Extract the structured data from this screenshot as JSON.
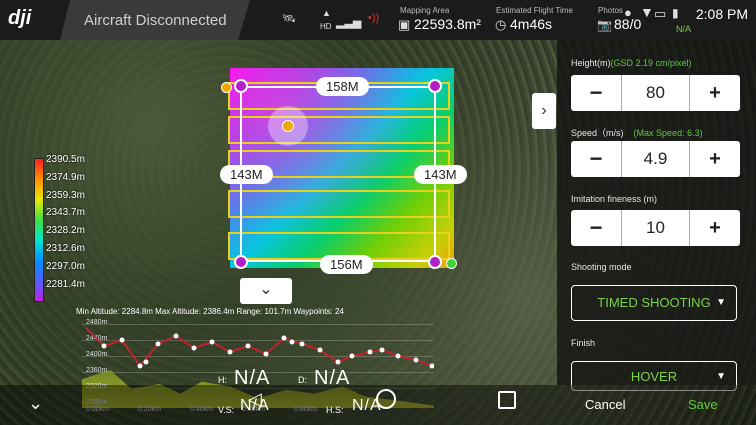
{
  "topbar": {
    "status": "Aircraft Disconnected",
    "hd_label": "HD",
    "mapping_area_label": "Mapping Area",
    "mapping_area_value": "22593.8m²",
    "flight_time_label": "Estimated Flight Time",
    "flight_time_value": "4m46s",
    "photos_label": "Photos",
    "photos_value": "88/0",
    "time": "2:08 PM",
    "na": "N/A"
  },
  "map": {
    "dim_top": "158M",
    "dim_bottom": "156M",
    "dim_left": "143M",
    "dim_right": "143M"
  },
  "legend": {
    "labels": [
      "2390.5m",
      "2374.9m",
      "2359.3m",
      "2343.7m",
      "2328.2m",
      "2312.6m",
      "2297.0m",
      "2281.4m"
    ]
  },
  "panel": {
    "height_label": "Height(m)",
    "height_gsd": "(GSD 2.19 cm/pixel)",
    "height_value": "80",
    "speed_label": "Speed（m/s)",
    "speed_max": "(Max Speed: 6.3)",
    "speed_value": "4.9",
    "fineness_label": "Imitation fineness (m)",
    "fineness_value": "10",
    "shooting_label": "Shooting mode",
    "shooting_value": "TIMED SHOOTING",
    "finish_label": "Finish",
    "finish_value": "HOVER",
    "minus": "−",
    "plus": "+"
  },
  "profile": {
    "summary": "Min Altitude: 2284.8m Max Altitude: 2386.4m Range: 101.7m Waypoints: 24",
    "y_ticks": [
      "2480m",
      "2440m",
      "2400m",
      "2360m",
      "2320m",
      "2280m"
    ],
    "x_ticks": [
      "0.00km",
      "0.20km",
      "0.40km",
      "0.60km",
      "0.80km"
    ]
  },
  "bottom": {
    "h_label": "H:",
    "h_value": "N/A",
    "d_label": "D:",
    "d_value": "N/A",
    "vs_label": "V.S:",
    "vs_value": "N/A",
    "hs_label": "H.S:",
    "hs_value": "N/A",
    "cancel": "Cancel",
    "save": "Save"
  }
}
